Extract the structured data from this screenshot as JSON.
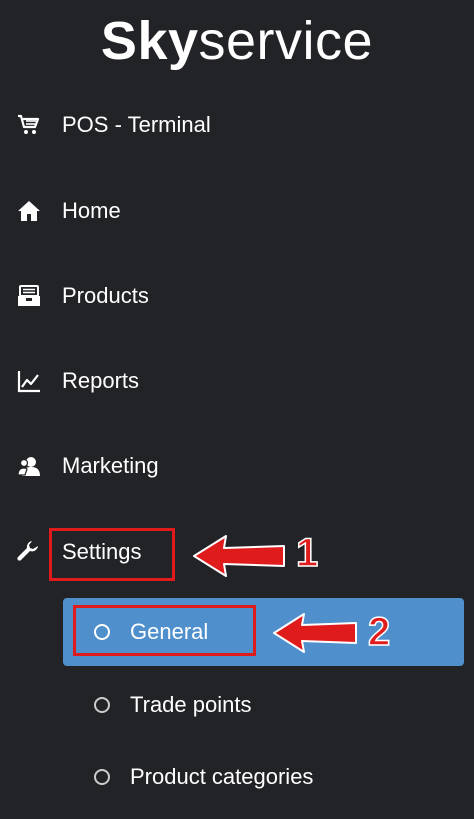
{
  "logo": {
    "bold": "Sky",
    "regular": "service"
  },
  "nav": {
    "items": [
      {
        "label": "POS - Terminal",
        "icon": "cart-icon"
      },
      {
        "label": "Home",
        "icon": "home-icon"
      },
      {
        "label": "Products",
        "icon": "products-box-icon"
      },
      {
        "label": "Reports",
        "icon": "line-chart-icon"
      },
      {
        "label": "Marketing",
        "icon": "users-icon"
      },
      {
        "label": "Settings",
        "icon": "wrench-icon"
      }
    ],
    "settings_submenu": [
      {
        "label": "General",
        "active": true
      },
      {
        "label": "Trade points",
        "active": false
      },
      {
        "label": "Product categories",
        "active": false
      }
    ]
  },
  "annotations": {
    "step_1": "1",
    "step_2": "2",
    "highlight_color": "#e01b1b",
    "active_color": "#4e8fcc"
  }
}
